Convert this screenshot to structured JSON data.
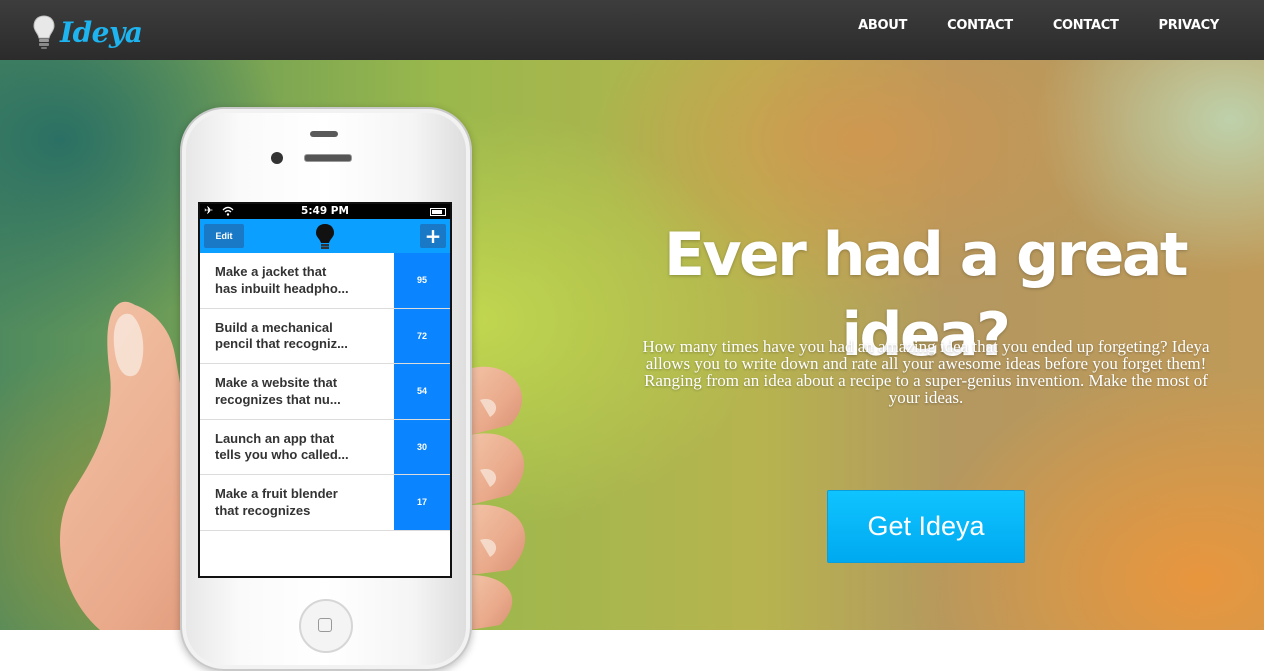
{
  "brand": {
    "name": "Ideya",
    "accent": "#1eb4f0"
  },
  "nav": {
    "items": [
      {
        "label": "ABOUT"
      },
      {
        "label": "CONTACT"
      },
      {
        "label": "CONTACT"
      },
      {
        "label": "PRIVACY"
      }
    ]
  },
  "hero": {
    "headline": "Ever had a great idea?",
    "description": "How many times have you had an amazing idea that you ended up forgeting? Ideya allows you to write down and rate all your awesome ideas before you forget them! Ranging from an idea about a recipe to a super-genius invention. Make the most of your ideas.",
    "cta_label": "Get Ideya",
    "cta_color": "#00b4f5"
  },
  "phone": {
    "status_time": "5:49 PM",
    "edit_label": "Edit",
    "add_label": "+",
    "app_color": "#0b9fff",
    "ideas": [
      {
        "line1": "Make a jacket that",
        "line2": "has inbuilt headpho...",
        "score": "95"
      },
      {
        "line1": "Build a mechanical",
        "line2": "pencil that recogniz...",
        "score": "72"
      },
      {
        "line1": "Make a website that",
        "line2": "recognizes that nu...",
        "score": "54"
      },
      {
        "line1": "Launch an app that",
        "line2": "tells you who called...",
        "score": "30"
      },
      {
        "line1": "Make a fruit blender",
        "line2": "that recognizes",
        "score": "17"
      }
    ]
  }
}
